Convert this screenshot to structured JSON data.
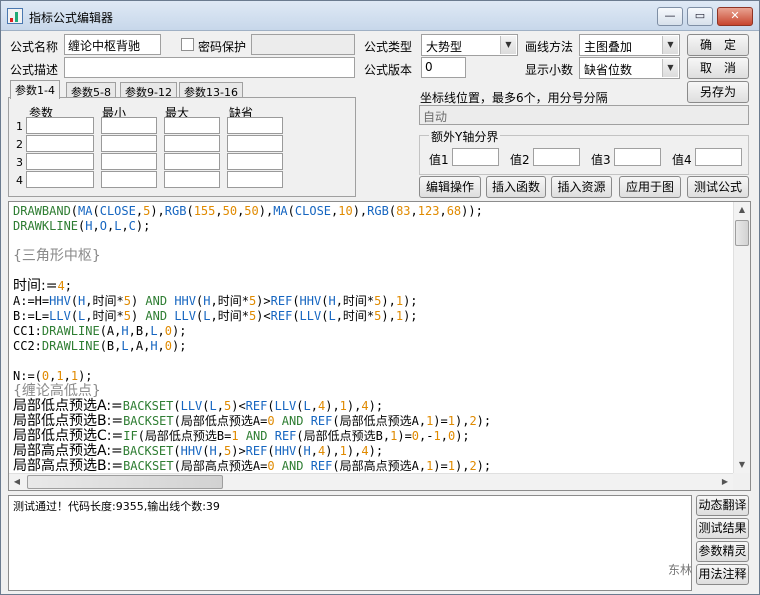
{
  "window": {
    "title": "指标公式编辑器",
    "min": "—",
    "max": "▭",
    "close": "✕"
  },
  "form": {
    "name_label": "公式名称",
    "name_value": "缠论中枢背驰",
    "password_label": "密码保护",
    "desc_label": "公式描述",
    "desc_value": "",
    "type_label": "公式类型",
    "type_value": "大势型",
    "version_label": "公式版本",
    "version_value": "0",
    "draw_label": "画线方法",
    "draw_value": "主图叠加",
    "decimal_label": "显示小数",
    "decimal_value": "缺省位数"
  },
  "buttons": {
    "ok": "确　定",
    "cancel": "取　消",
    "save_as": "另存为"
  },
  "tabs": [
    "参数1-4",
    "参数5-8",
    "参数9-12",
    "参数13-16"
  ],
  "param_headers": [
    "参数",
    "最小",
    "最大",
    "缺省"
  ],
  "param_rows": [
    "1",
    "2",
    "3",
    "4"
  ],
  "coord": {
    "label": "坐标线位置，最多6个，用分号分隔",
    "value": "自动"
  },
  "extra_y": {
    "title": "额外Y轴分界",
    "labels": [
      "值1",
      "值2",
      "值3",
      "值4"
    ]
  },
  "tool_buttons": [
    "编辑操作",
    "插入函数",
    "插入资源",
    "应用于图",
    "测试公式"
  ],
  "code_lines": [
    [
      [
        "DRAWBAND",
        "g"
      ],
      [
        "(",
        "k"
      ],
      [
        "MA",
        "b"
      ],
      [
        "(",
        "k"
      ],
      [
        "CLOSE",
        "b"
      ],
      [
        ",",
        "k"
      ],
      [
        "5",
        "o"
      ],
      [
        "),",
        "k"
      ],
      [
        "RGB",
        "b"
      ],
      [
        "(",
        "k"
      ],
      [
        "155",
        "o"
      ],
      [
        ",",
        "k"
      ],
      [
        "50",
        "o"
      ],
      [
        ",",
        "k"
      ],
      [
        "50",
        "o"
      ],
      [
        "),",
        "k"
      ],
      [
        "MA",
        "b"
      ],
      [
        "(",
        "k"
      ],
      [
        "CLOSE",
        "b"
      ],
      [
        ",",
        "k"
      ],
      [
        "10",
        "o"
      ],
      [
        "),",
        "k"
      ],
      [
        "RGB",
        "b"
      ],
      [
        "(",
        "k"
      ],
      [
        "83",
        "o"
      ],
      [
        ",",
        "k"
      ],
      [
        "123",
        "o"
      ],
      [
        ",",
        "k"
      ],
      [
        "68",
        "o"
      ],
      [
        "));",
        "k"
      ]
    ],
    [
      [
        "DRAWKLINE",
        "g"
      ],
      [
        "(",
        "k"
      ],
      [
        "H",
        "b"
      ],
      [
        ",",
        "k"
      ],
      [
        "O",
        "b"
      ],
      [
        ",",
        "k"
      ],
      [
        "L",
        "b"
      ],
      [
        ",",
        "k"
      ],
      [
        "C",
        "b"
      ],
      [
        ");",
        "k"
      ]
    ],
    [],
    [
      [
        "{三角形中枢}",
        "grey-big"
      ]
    ],
    [],
    [
      [
        "时间:=",
        "k-big"
      ],
      [
        "4",
        "o"
      ],
      [
        ";",
        "k"
      ]
    ],
    [
      [
        "A:=H=",
        "k"
      ],
      [
        "HHV",
        "b"
      ],
      [
        "(",
        "k"
      ],
      [
        "H",
        "b"
      ],
      [
        ",时间*",
        "k"
      ],
      [
        "5",
        "o"
      ],
      [
        ") ",
        "k"
      ],
      [
        "AND ",
        "g"
      ],
      [
        "HHV",
        "b"
      ],
      [
        "(",
        "k"
      ],
      [
        "H",
        "b"
      ],
      [
        ",时间*",
        "k"
      ],
      [
        "5",
        "o"
      ],
      [
        ")>",
        "k"
      ],
      [
        "REF",
        "b"
      ],
      [
        "(",
        "k"
      ],
      [
        "HHV",
        "b"
      ],
      [
        "(",
        "k"
      ],
      [
        "H",
        "b"
      ],
      [
        ",时间*",
        "k"
      ],
      [
        "5",
        "o"
      ],
      [
        "),",
        "k"
      ],
      [
        "1",
        "o"
      ],
      [
        ");",
        "k"
      ]
    ],
    [
      [
        "B:=L=",
        "k"
      ],
      [
        "LLV",
        "b"
      ],
      [
        "(",
        "k"
      ],
      [
        "L",
        "b"
      ],
      [
        ",时间*",
        "k"
      ],
      [
        "5",
        "o"
      ],
      [
        ") ",
        "k"
      ],
      [
        "AND ",
        "g"
      ],
      [
        "LLV",
        "b"
      ],
      [
        "(",
        "k"
      ],
      [
        "L",
        "b"
      ],
      [
        ",时间*",
        "k"
      ],
      [
        "5",
        "o"
      ],
      [
        ")<",
        "k"
      ],
      [
        "REF",
        "b"
      ],
      [
        "(",
        "k"
      ],
      [
        "LLV",
        "b"
      ],
      [
        "(",
        "k"
      ],
      [
        "L",
        "b"
      ],
      [
        ",时间*",
        "k"
      ],
      [
        "5",
        "o"
      ],
      [
        "),",
        "k"
      ],
      [
        "1",
        "o"
      ],
      [
        ");",
        "k"
      ]
    ],
    [
      [
        "CC1:",
        "k"
      ],
      [
        "DRAWLINE",
        "g"
      ],
      [
        "(A,",
        "k"
      ],
      [
        "H",
        "b"
      ],
      [
        ",B,",
        "k"
      ],
      [
        "L",
        "b"
      ],
      [
        ",",
        "k"
      ],
      [
        "0",
        "o"
      ],
      [
        ");",
        "k"
      ]
    ],
    [
      [
        "CC2:",
        "k"
      ],
      [
        "DRAWLINE",
        "g"
      ],
      [
        "(B,",
        "k"
      ],
      [
        "L",
        "b"
      ],
      [
        ",A,",
        "k"
      ],
      [
        "H",
        "b"
      ],
      [
        ",",
        "k"
      ],
      [
        "0",
        "o"
      ],
      [
        ");",
        "k"
      ]
    ],
    [],
    [
      [
        "N:=(",
        "k"
      ],
      [
        "0",
        "o"
      ],
      [
        ",",
        "k"
      ],
      [
        "1",
        "o"
      ],
      [
        ",",
        "k"
      ],
      [
        "1",
        "o"
      ],
      [
        ");",
        "k"
      ]
    ],
    [
      [
        "{缠论高低点}",
        "grey-big"
      ]
    ],
    [
      [
        "局部低点预选A:=",
        "k-big"
      ],
      [
        "BACKSET",
        "g"
      ],
      [
        "(",
        "k"
      ],
      [
        "LLV",
        "b"
      ],
      [
        "(",
        "k"
      ],
      [
        "L",
        "b"
      ],
      [
        ",",
        "k"
      ],
      [
        "5",
        "o"
      ],
      [
        ")<",
        "k"
      ],
      [
        "REF",
        "b"
      ],
      [
        "(",
        "k"
      ],
      [
        "LLV",
        "b"
      ],
      [
        "(",
        "k"
      ],
      [
        "L",
        "b"
      ],
      [
        ",",
        "k"
      ],
      [
        "4",
        "o"
      ],
      [
        "),",
        "k"
      ],
      [
        "1",
        "o"
      ],
      [
        "),",
        "k"
      ],
      [
        "4",
        "o"
      ],
      [
        ");",
        "k"
      ]
    ],
    [
      [
        "局部低点预选B:=",
        "k-big"
      ],
      [
        "BACKSET",
        "g"
      ],
      [
        "(局部低点预选A=",
        "k"
      ],
      [
        "0",
        "o"
      ],
      [
        " AND ",
        "g"
      ],
      [
        "REF",
        "b"
      ],
      [
        "(局部低点预选A,",
        "k"
      ],
      [
        "1",
        "o"
      ],
      [
        ")=",
        "k"
      ],
      [
        "1",
        "o"
      ],
      [
        "),",
        "k"
      ],
      [
        "2",
        "o"
      ],
      [
        ");",
        "k"
      ]
    ],
    [
      [
        "局部低点预选C:=",
        "k-big"
      ],
      [
        "IF",
        "g"
      ],
      [
        "(局部低点预选B=",
        "k"
      ],
      [
        "1",
        "o"
      ],
      [
        " AND ",
        "g"
      ],
      [
        "REF",
        "b"
      ],
      [
        "(局部低点预选B,",
        "k"
      ],
      [
        "1",
        "o"
      ],
      [
        ")=",
        "k"
      ],
      [
        "0",
        "o"
      ],
      [
        ",-",
        "k"
      ],
      [
        "1",
        "o"
      ],
      [
        ",",
        "k"
      ],
      [
        "0",
        "o"
      ],
      [
        ");",
        "k"
      ]
    ],
    [
      [
        "局部高点预选A:=",
        "k-big"
      ],
      [
        "BACKSET",
        "g"
      ],
      [
        "(",
        "k"
      ],
      [
        "HHV",
        "b"
      ],
      [
        "(",
        "k"
      ],
      [
        "H",
        "b"
      ],
      [
        ",",
        "k"
      ],
      [
        "5",
        "o"
      ],
      [
        ")>",
        "k"
      ],
      [
        "REF",
        "b"
      ],
      [
        "(",
        "k"
      ],
      [
        "HHV",
        "b"
      ],
      [
        "(",
        "k"
      ],
      [
        "H",
        "b"
      ],
      [
        ",",
        "k"
      ],
      [
        "4",
        "o"
      ],
      [
        "),",
        "k"
      ],
      [
        "1",
        "o"
      ],
      [
        "),",
        "k"
      ],
      [
        "4",
        "o"
      ],
      [
        ");",
        "k"
      ]
    ],
    [
      [
        "局部高点预选B:=",
        "k-big"
      ],
      [
        "BACKSET",
        "g"
      ],
      [
        "(局部高点预选A=",
        "k"
      ],
      [
        "0",
        "o"
      ],
      [
        " AND ",
        "g"
      ],
      [
        "REF",
        "b"
      ],
      [
        "(局部高点预选A,",
        "k"
      ],
      [
        "1",
        "o"
      ],
      [
        ")=",
        "k"
      ],
      [
        "1",
        "o"
      ],
      [
        "),",
        "k"
      ],
      [
        "2",
        "o"
      ],
      [
        ");",
        "k"
      ]
    ]
  ],
  "output_text": "测试通过！代码长度:9355,输出线个数:39",
  "side_buttons": [
    "动态翻译",
    "测试结果",
    "参数精灵",
    "用法注释"
  ],
  "watermark": "东林",
  "colors": {
    "keyword_green": "#2e7d32",
    "func_blue": "#1565c0",
    "number_orange": "#e08a00",
    "comment_grey": "#8a8a8a"
  }
}
